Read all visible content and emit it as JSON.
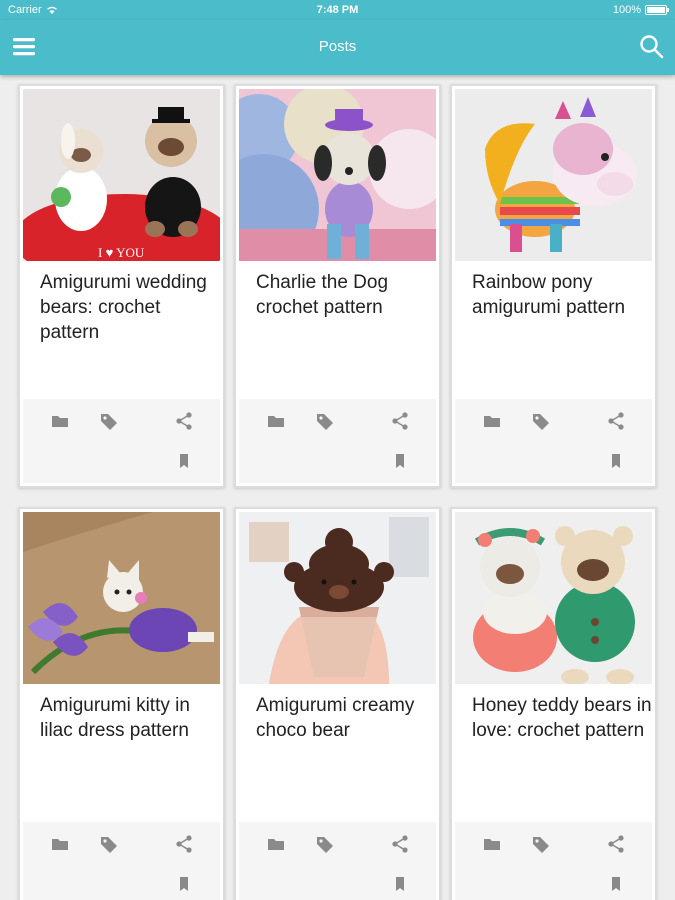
{
  "status_bar": {
    "carrier": "Carrier",
    "time": "7:48 PM",
    "battery": "100%"
  },
  "app_bar": {
    "title": "Posts",
    "menu_icon": "hamburger-menu-icon",
    "search_icon": "search-icon"
  },
  "colors": {
    "accent": "#4bbcc9",
    "card_bg": "#ffffff",
    "action_icon": "#8a8a8a"
  },
  "posts": [
    {
      "title": "Amigurumi wedding bears: crochet pattern",
      "image": "wedding-bears"
    },
    {
      "title": "Charlie the Dog crochet pattern",
      "image": "crochet-dog"
    },
    {
      "title": "Rainbow pony amigurumi pattern",
      "image": "rainbow-pony"
    },
    {
      "title": "Amigurumi kitty in lilac dress pattern",
      "image": "kitty-lilac-dress"
    },
    {
      "title": "Amigurumi creamy choco bear",
      "image": "choco-bear"
    },
    {
      "title": "Honey teddy bears in love: crochet pattern",
      "image": "honey-teddy-bears"
    }
  ],
  "card_actions": [
    "folder-icon",
    "tag-icon",
    "share-icon",
    "bookmark-icon"
  ]
}
